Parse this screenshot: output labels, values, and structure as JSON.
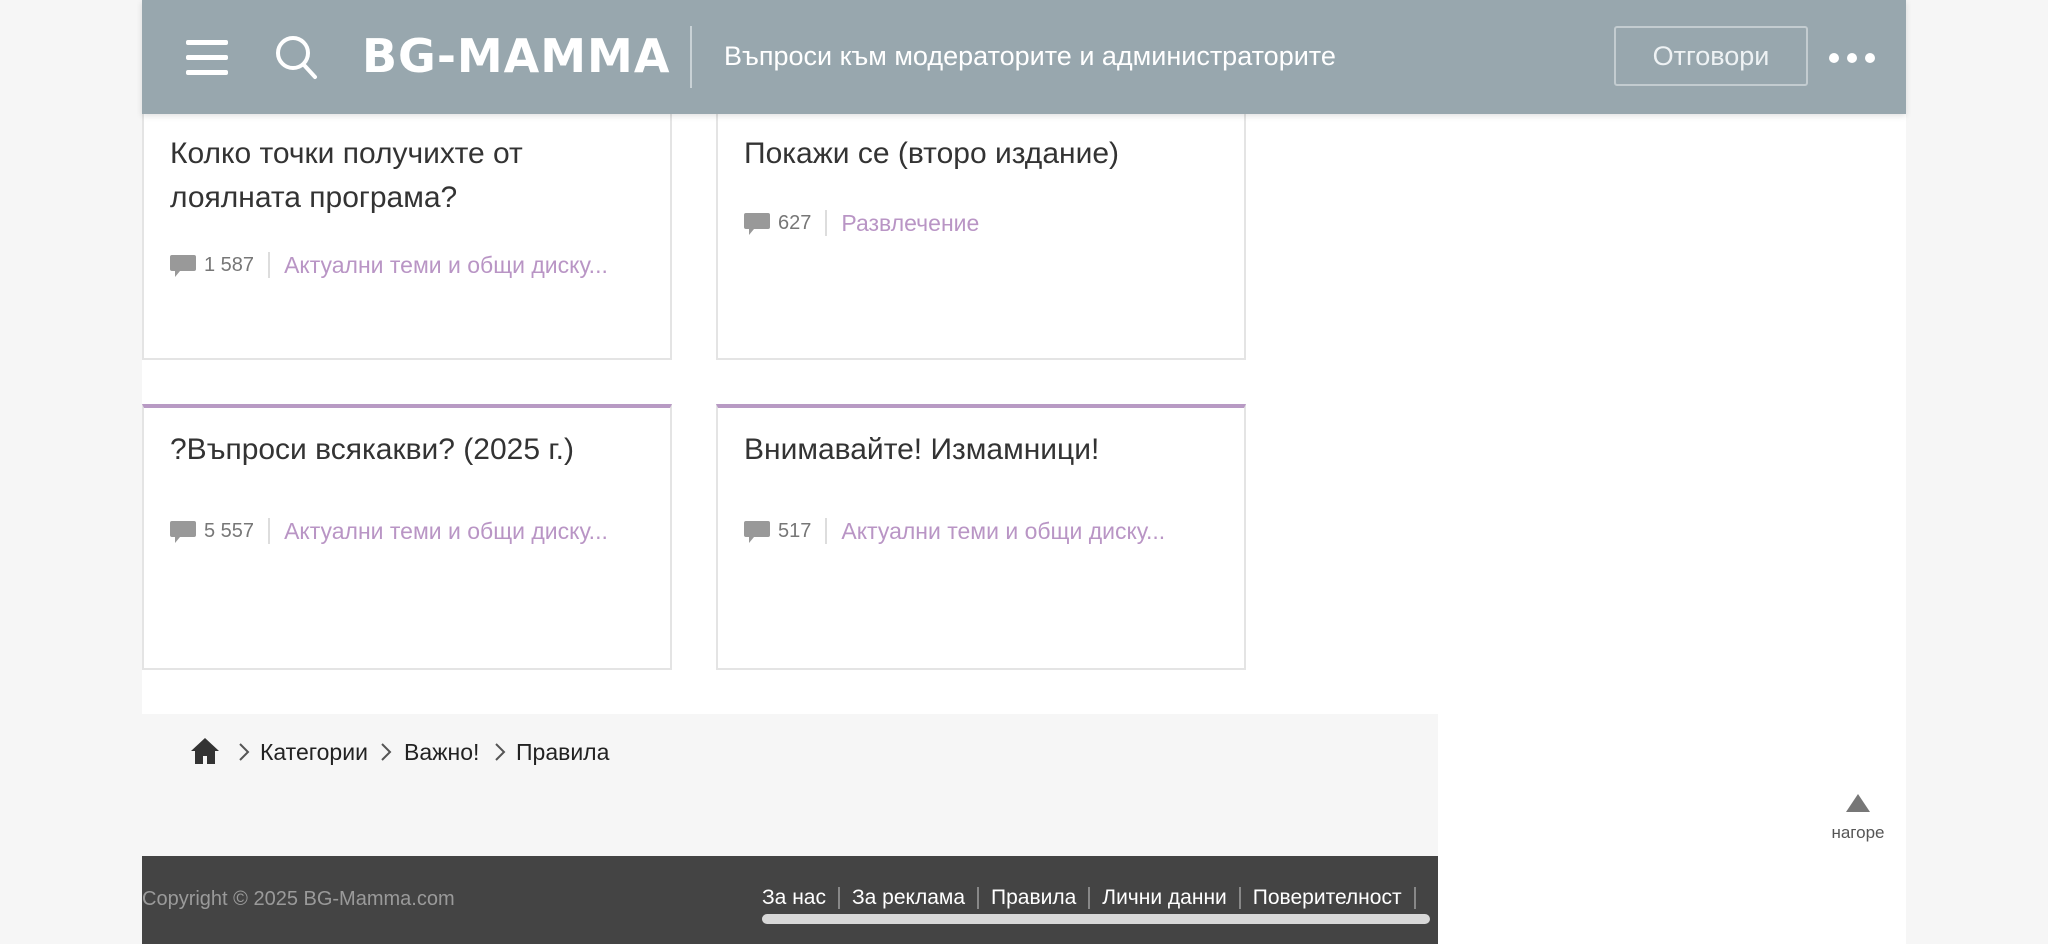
{
  "header": {
    "logo": "BG-MAMMA",
    "title": "Въпроси към модераторите и администраторите",
    "reply_button": "Отговори"
  },
  "cards": [
    {
      "title": "Колко точки получихте от лоялната програма?",
      "count": "1 587",
      "category": "Актуални теми и общи диску..."
    },
    {
      "title": "Покажи се (второ издание)",
      "count": "627",
      "category": "Развлечение"
    },
    {
      "title": "?Въпроси всякакви? (2025 г.)",
      "count": "5 557",
      "category": "Актуални теми и общи диску..."
    },
    {
      "title": "Внимавайте! Измамници!",
      "count": "517",
      "category": "Актуални теми и общи диску..."
    }
  ],
  "breadcrumb": [
    "Категории",
    "Важно!",
    "Правила"
  ],
  "back_to_top": "нагоре",
  "footer": {
    "copyright": "Copyright © 2025 BG-Mamma.com",
    "links": [
      "За нас",
      "За реклама",
      "Правила",
      "Лични данни",
      "Поверителност"
    ]
  },
  "colors": {
    "header_bg": "#98a7ae",
    "accent": "#b89ac4",
    "category_link": "#b995c5",
    "footer_bg": "#444444"
  },
  "icons": [
    "hamburger-icon",
    "search-icon",
    "more-icon",
    "comment-icon",
    "home-icon",
    "chevron-right-icon",
    "arrow-up-icon"
  ]
}
